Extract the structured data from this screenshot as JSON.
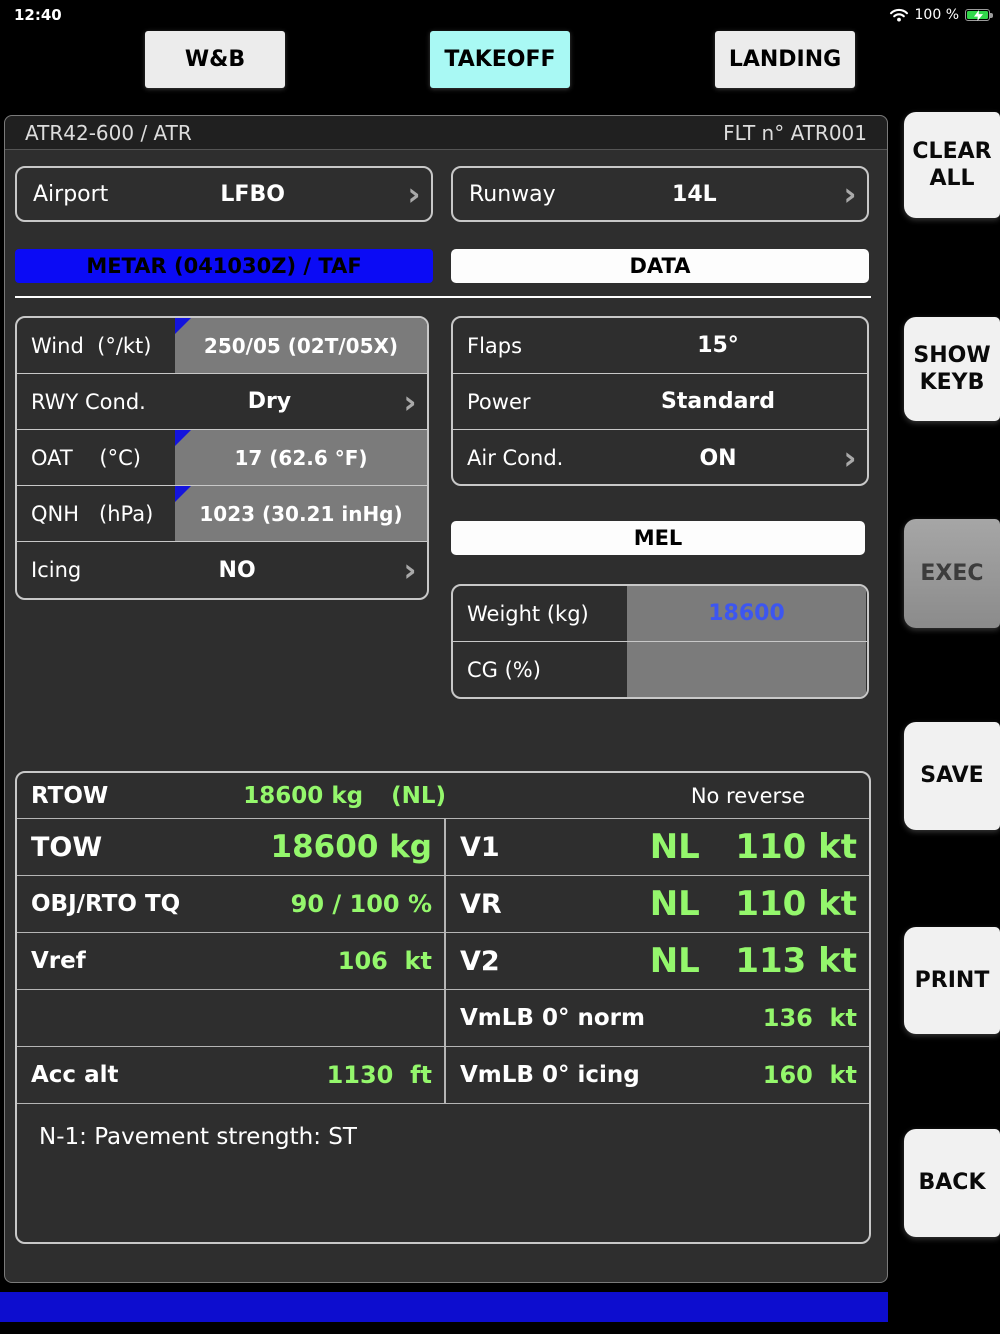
{
  "status_bar": {
    "time": "12:40",
    "battery_pct": "100 %"
  },
  "tabs": {
    "wb": "W&B",
    "takeoff": "TAKEOFF",
    "landing": "LANDING"
  },
  "header": {
    "aircraft": "ATR42-600 / ATR",
    "flight_no": "FLT n° ATR001"
  },
  "selectors": {
    "airport_label": "Airport",
    "airport_value": "LFBO",
    "runway_label": "Runway",
    "runway_value": "14L",
    "metar_button": "METAR (041030Z) / TAF",
    "data_button": "DATA",
    "mel_button": "MEL"
  },
  "left_fields": [
    {
      "label": "Wind  (°/kt)",
      "value": "250/05 (02T/05X)"
    },
    {
      "label": "RWY Cond.",
      "value": "Dry"
    },
    {
      "label": "OAT    (°C)",
      "value": "17 (62.6 °F)"
    },
    {
      "label": "QNH   (hPa)",
      "value": "1023 (30.21 inHg)"
    },
    {
      "label": "Icing",
      "value": "NO"
    }
  ],
  "right_fields": [
    {
      "label": "Flaps",
      "value": "15°"
    },
    {
      "label": "Power",
      "value": "Standard"
    },
    {
      "label": "Air Cond.",
      "value": "ON"
    }
  ],
  "weight_fields": [
    {
      "label": "Weight (kg)",
      "value": "18600"
    },
    {
      "label": "CG (%)",
      "value": ""
    }
  ],
  "results": {
    "rtow_label": "RTOW",
    "rtow_value": "18600 kg",
    "rtow_flag": "(NL)",
    "reverse_note": "No reverse",
    "rows_left": [
      {
        "label": "TOW",
        "value": "18600 kg"
      },
      {
        "label": "OBJ/RTO TQ",
        "value": "90 / 100 %"
      },
      {
        "label": "Vref",
        "value": "106  kt"
      },
      {
        "label": "",
        "value": ""
      },
      {
        "label": "Acc alt",
        "value": "1130  ft"
      }
    ],
    "rows_right": [
      {
        "label": "V1",
        "value": "NL   110 kt"
      },
      {
        "label": "VR",
        "value": "NL   110 kt"
      },
      {
        "label": "V2",
        "value": "NL   113 kt"
      },
      {
        "label": "VmLB 0° norm",
        "value": "136  kt"
      },
      {
        "label": "VmLB 0° icing",
        "value": "160  kt"
      }
    ],
    "note": "N-1: Pavement strength: ST"
  },
  "sidebar": {
    "clear_all": "CLEAR ALL",
    "show_keyb": "SHOW KEYB",
    "exec": "EXEC",
    "save": "SAVE",
    "print": "PRINT",
    "back": "BACK"
  }
}
